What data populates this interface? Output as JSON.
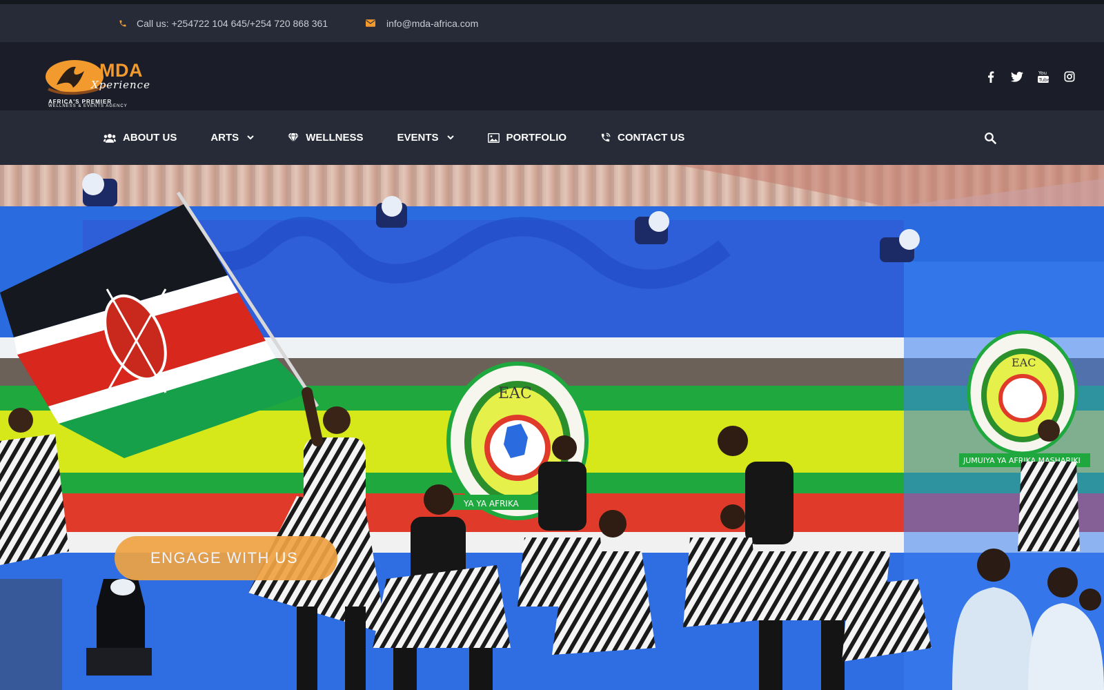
{
  "contact": {
    "phone_text": "Call us: +254722 104 645/+254 720 868 361",
    "email_text": "info@mda-africa.com"
  },
  "logo": {
    "brand": "MDA",
    "script": "Xperience",
    "tagline_1": "AFRICA'S PREMIER",
    "tagline_2": "WELLNESS & EVENTS AGENCY"
  },
  "social": [
    "facebook-icon",
    "twitter-icon",
    "youtube-icon",
    "instagram-icon"
  ],
  "nav": {
    "items": [
      {
        "label": "ABOUT US",
        "icon": "users-icon",
        "dropdown": false
      },
      {
        "label": "ARTS",
        "icon": "",
        "dropdown": true
      },
      {
        "label": "WELLNESS",
        "icon": "diamond-icon",
        "dropdown": false
      },
      {
        "label": "EVENTS",
        "icon": "",
        "dropdown": true
      },
      {
        "label": "PORTFOLIO",
        "icon": "image-icon",
        "dropdown": false
      },
      {
        "label": "CONTACT US",
        "icon": "phone-icon",
        "dropdown": false
      }
    ],
    "search_icon": "search-icon"
  },
  "hero": {
    "cta_label": "ENGAGE WITH US",
    "emblem_text": "EAC",
    "banner_text": "JUMUIYA YA AFRIKA MASHARIKI"
  },
  "colors": {
    "accent": "#f29a2e",
    "topbar_bg": "#272b37",
    "header_bg": "#1b1e28",
    "nav_bg": "#272b37",
    "cta_bg": "#f0a343"
  }
}
